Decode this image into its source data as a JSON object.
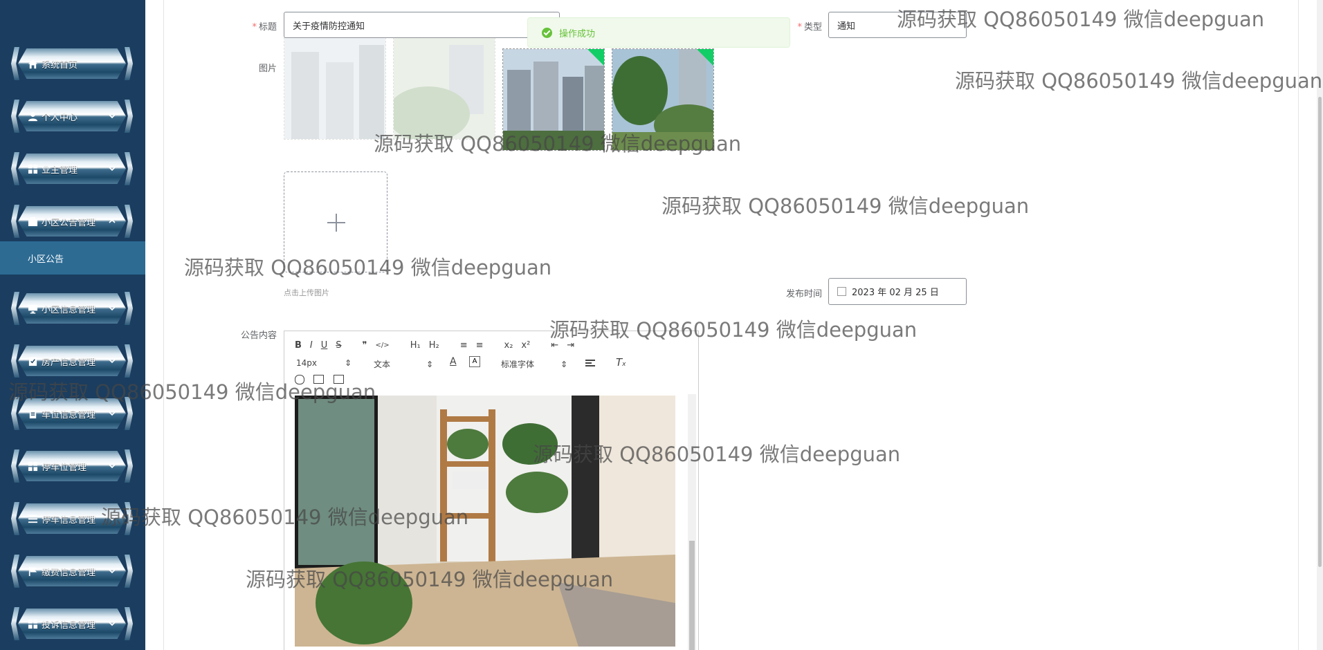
{
  "sidebar": {
    "items": [
      {
        "label": "系统首页",
        "icon": "home-icon"
      },
      {
        "label": "个人中心",
        "icon": "user-icon"
      },
      {
        "label": "业主管理",
        "icon": "grid-icon"
      },
      {
        "label": "小区公告管理",
        "icon": "briefcase-icon"
      },
      {
        "label": "小区信息管理",
        "icon": "monitor-icon"
      },
      {
        "label": "房产信息管理",
        "icon": "checklist-icon"
      },
      {
        "label": "车位信息管理",
        "icon": "clipboard-icon"
      },
      {
        "label": "停车位管理",
        "icon": "grid-icon"
      },
      {
        "label": "停车信息管理",
        "icon": "list-icon"
      },
      {
        "label": "缴费信息管理",
        "icon": "flag-icon"
      },
      {
        "label": "投诉信息管理",
        "icon": "grid-icon"
      }
    ],
    "submenu_label": "小区公告"
  },
  "form": {
    "title_label": "标题",
    "title_value": "关于疫情防控通知",
    "type_label": "类型",
    "type_value": "通知",
    "image_label": "图片",
    "upload_hint": "点击上传图片",
    "publish_time_label": "发布时间",
    "publish_time_value": "2023 年 02 月 25 日",
    "content_label": "公告内容"
  },
  "toast": {
    "message": "操作成功"
  },
  "editor": {
    "toolbar_row1": [
      "B",
      "I",
      "U",
      "S",
      "❞",
      "</>",
      "H₁",
      "H₂",
      "≡",
      "≡",
      "x₂",
      "x²",
      "⇤",
      "⇥"
    ],
    "font_size": "14px",
    "text_style": "文本",
    "font_family": "标准字体"
  },
  "watermark": "源码获取 QQ86050149 微信deepguan"
}
